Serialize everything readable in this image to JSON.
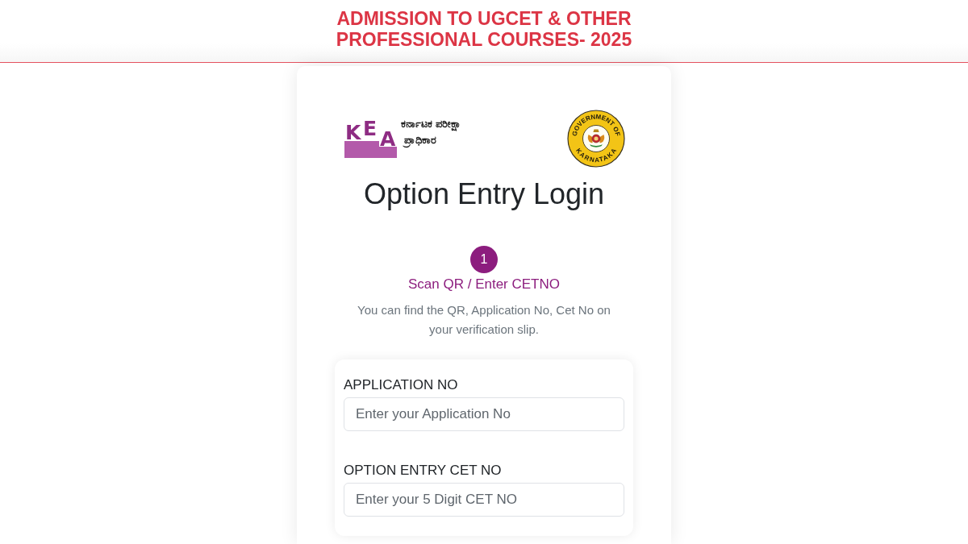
{
  "header": {
    "title": "ADMISSION TO UGCET & OTHER PROFESSIONAL COURSES- 2025"
  },
  "logo": {
    "letters": [
      "K",
      "E",
      "A"
    ],
    "name_lines": [
      "ಕರ್ನಾಟಕ ಪರೀಕ್ಷಾ",
      "ಪ್ರಾಧಿಕಾರ"
    ]
  },
  "emblem": {
    "top_text": "GOVERNMENT OF",
    "bottom_text": "KARNATAKA"
  },
  "page_title": "Option Entry Login",
  "steps": [
    {
      "number": "1",
      "label": "Scan QR / Enter CETNO",
      "selected": true
    }
  ],
  "help_text": "You can find the QR, Application No, Cet No on your verification slip.",
  "form": {
    "fields": [
      {
        "label": "APPLICATION NO",
        "placeholder": "Enter your Application No"
      },
      {
        "label": "OPTION ENTRY CET NO",
        "placeholder": "Enter your 5 Digit CET NO"
      }
    ]
  }
}
